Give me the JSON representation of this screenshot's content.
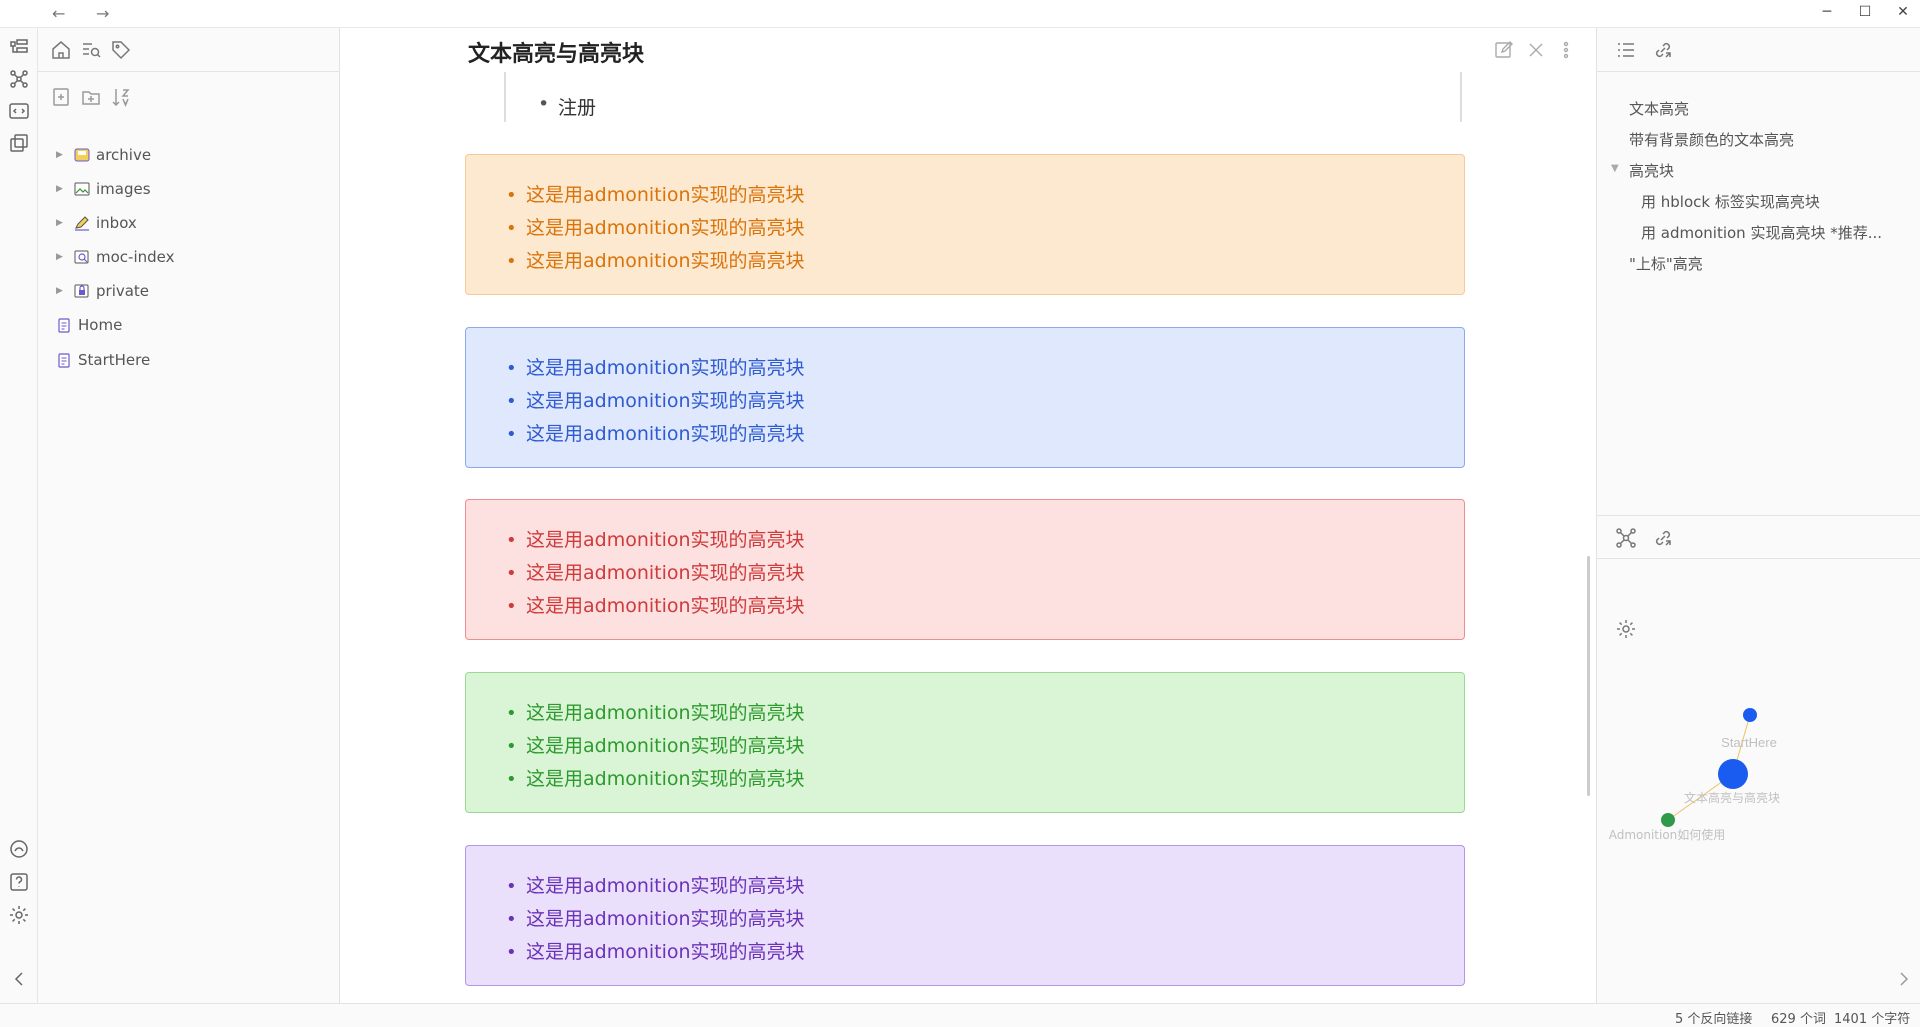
{
  "titlebar": {
    "back_icon": "arrow-left-icon",
    "forward_icon": "arrow-right-icon",
    "minimize": "─",
    "maximize": "☐",
    "close": "✕"
  },
  "file_tree": {
    "items": [
      {
        "label": "archive",
        "type": "folder"
      },
      {
        "label": "images",
        "type": "folder"
      },
      {
        "label": "inbox",
        "type": "folder"
      },
      {
        "label": "moc-index",
        "type": "folder"
      },
      {
        "label": "private",
        "type": "folder"
      },
      {
        "label": "Home",
        "type": "file"
      },
      {
        "label": "StartHere",
        "type": "file"
      }
    ]
  },
  "note": {
    "title": "文本高亮与高亮块",
    "previous_list_item": "注册"
  },
  "admonitions": [
    {
      "color_text": "#d9740b",
      "color_bg": "#fde8d0",
      "color_border": "#f6c89a",
      "items": [
        "这是用admonition实现的高亮块",
        "这是用admonition实现的高亮块",
        "这是用admonition实现的高亮块"
      ]
    },
    {
      "color_text": "#2f5bd0",
      "color_bg": "#dfe8fd",
      "color_border": "#8ea8ee",
      "items": [
        "这是用admonition实现的高亮块",
        "这是用admonition实现的高亮块",
        "这是用admonition实现的高亮块"
      ]
    },
    {
      "color_text": "#cf3a3a",
      "color_bg": "#fde0e0",
      "color_border": "#ee8d8d",
      "items": [
        "这是用admonition实现的高亮块",
        "这是用admonition实现的高亮块",
        "这是用admonition实现的高亮块"
      ]
    },
    {
      "color_text": "#2e9a2e",
      "color_bg": "#d9f5d6",
      "color_border": "#9bd896",
      "items": [
        "这是用admonition实现的高亮块",
        "这是用admonition实现的高亮块",
        "这是用admonition实现的高亮块"
      ]
    },
    {
      "color_text": "#6b32b8",
      "color_bg": "#ebe0fb",
      "color_border": "#b495e8",
      "items": [
        "这是用admonition实现的高亮块",
        "这是用admonition实现的高亮块",
        "这是用admonition实现的高亮块"
      ]
    }
  ],
  "outline": {
    "items": [
      {
        "label": "文本高亮",
        "level": 1
      },
      {
        "label": "带有背景颜色的文本高亮",
        "level": 1
      },
      {
        "label": "高亮块",
        "level": 1,
        "collapsible": true
      },
      {
        "label": "用 hblock 标签实现高亮块",
        "level": 2
      },
      {
        "label": "用 admonition 实现高亮块 *推荐...",
        "level": 2
      },
      {
        "label": "\"上标\"高亮",
        "level": 1
      }
    ]
  },
  "graph": {
    "nodes": [
      {
        "label": "StartHere",
        "color": "#1a5cf0"
      },
      {
        "label": "文本高亮与高亮块",
        "color": "#1a5cf0"
      },
      {
        "label": "Admonition如何使用",
        "color": "#2e9a4a"
      }
    ],
    "edge_color": "#f0c060"
  },
  "status": {
    "backlinks": "5 个反向链接",
    "words": "629 个词",
    "chars": "1401 个字符"
  }
}
